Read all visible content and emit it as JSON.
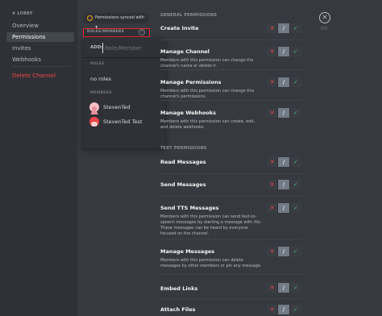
{
  "sidebar": {
    "category": "# LOBBY",
    "items": [
      {
        "label": "Overview"
      },
      {
        "label": "Permissions"
      },
      {
        "label": "Invites"
      },
      {
        "label": "Webhooks"
      }
    ],
    "delete_label": "Delete Channel"
  },
  "sync": {
    "text": "Permissions synced with",
    "count": "1"
  },
  "roles_members": {
    "header": "ROLES/MEMBERS",
    "plus": "+"
  },
  "popover": {
    "add_label": "ADD:",
    "placeholder": "Role/Member",
    "roles_heading": "ROLES",
    "no_roles": "no roles",
    "members_heading": "MEMBERS",
    "members": [
      {
        "name": "StevenTed",
        "avatar_color": "#f8c0c8"
      },
      {
        "name": "StevenTed Test",
        "avatar_color": "#f04747"
      }
    ]
  },
  "main": {
    "general_heading": "GENERAL PERMISSIONS",
    "text_heading": "TEXT PERMISSIONS",
    "general": [
      {
        "title": "Create Invite",
        "desc": ""
      },
      {
        "title": "Manage Channel",
        "desc": "Members with this permission can change the channel's name or delete it."
      },
      {
        "title": "Manage Permissions",
        "desc": "Members with this permission can change this channel's permissions."
      },
      {
        "title": "Manage Webhooks",
        "desc": "Members with this permission can create, edit, and delete webhooks."
      }
    ],
    "text": [
      {
        "title": "Read Messages",
        "desc": ""
      },
      {
        "title": "Send Messages",
        "desc": ""
      },
      {
        "title": "Send TTS Messages",
        "desc": "Members with this permission can send text-to-speech messages by starting a message with /tts. These messages can be heard by everyone focused on the channel."
      },
      {
        "title": "Manage Messages",
        "desc": "Members with this permission can delete messages by other members or pin any message."
      },
      {
        "title": "Embed Links",
        "desc": ""
      },
      {
        "title": "Attach Files",
        "desc": ""
      }
    ],
    "toggle": {
      "deny": "✕",
      "pass": "/",
      "allow": "✓"
    }
  },
  "esc": {
    "icon": "✕",
    "label": "ESC"
  },
  "colors": {
    "danger": "#f04747",
    "allow": "#43b581",
    "highlight": "#e3262d",
    "sync_icon": "#faa61a"
  }
}
